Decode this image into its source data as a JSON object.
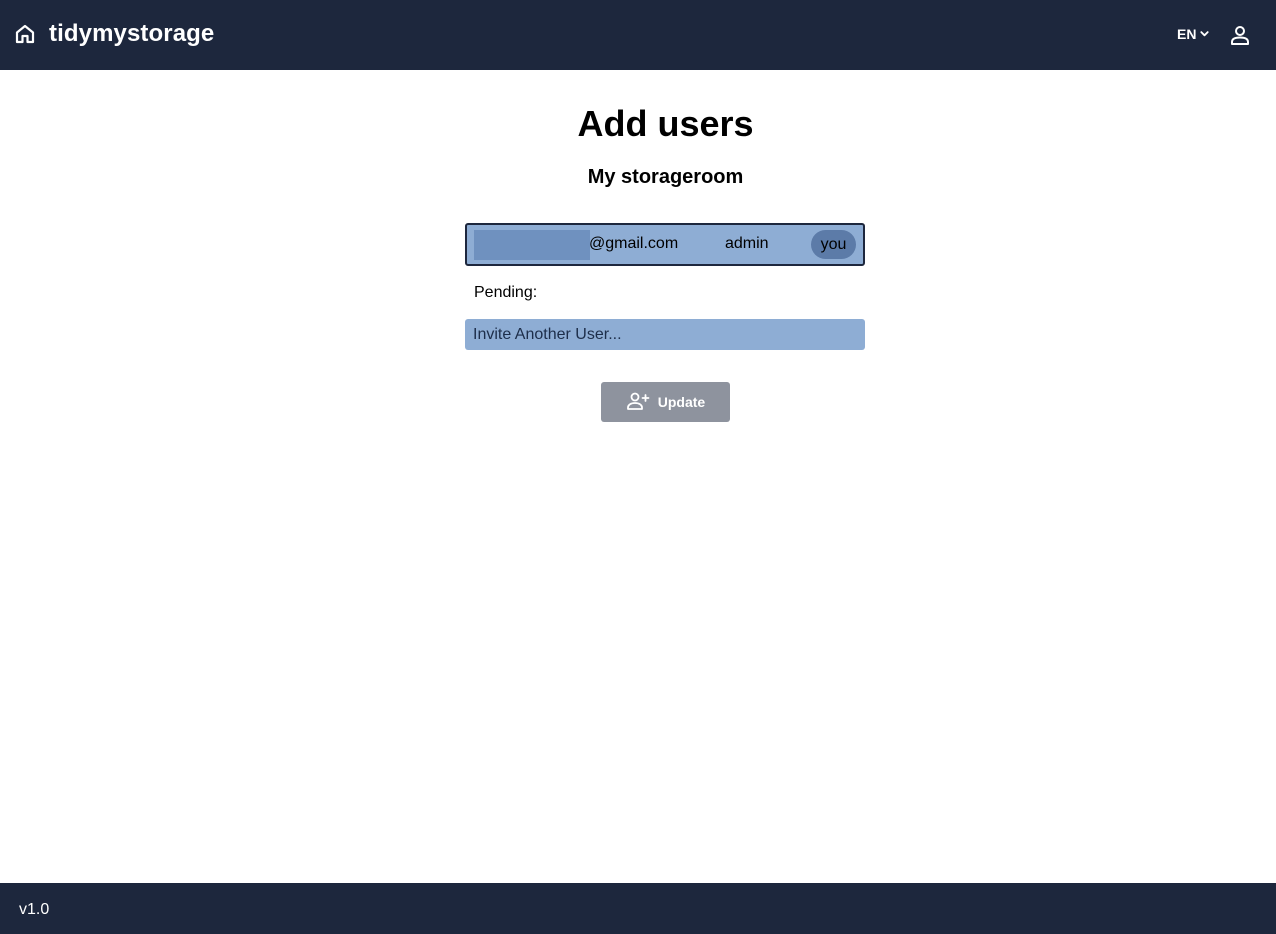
{
  "header": {
    "brand": "tidymystorage",
    "language": "EN",
    "icons": [
      "home-icon",
      "chevron-down-icon",
      "user-icon"
    ]
  },
  "main": {
    "title": "Add users",
    "storageroom": "My storageroom",
    "users": [
      {
        "email_domain": "@gmail.com",
        "role": "admin",
        "badge": "you"
      }
    ],
    "pending_label": "Pending:",
    "invite_placeholder": "Invite Another User...",
    "update_button": "Update"
  },
  "footer": {
    "version": "v1.0"
  },
  "colors": {
    "nav_bg": "#1d273d",
    "row_bg": "#8eadd4",
    "badge_bg": "#5c7ba8",
    "redacted": "#6f91bf",
    "button_bg": "#8e939e"
  }
}
